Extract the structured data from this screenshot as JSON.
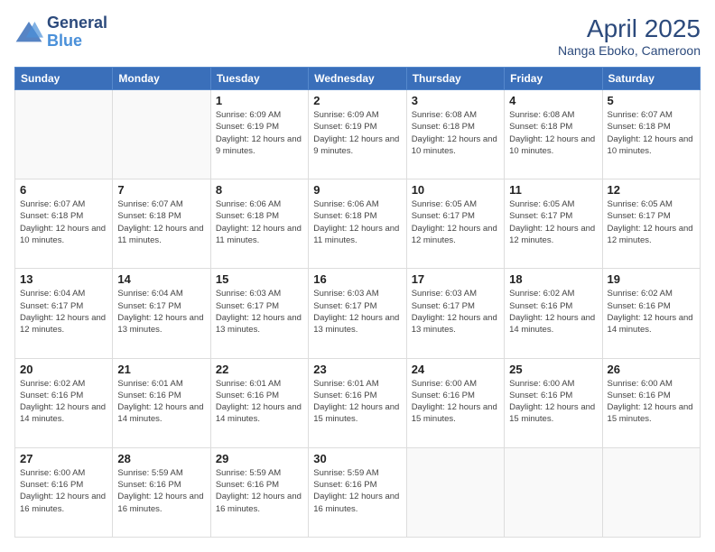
{
  "header": {
    "logo_line1": "General",
    "logo_line2": "Blue",
    "month": "April 2025",
    "location": "Nanga Eboko, Cameroon"
  },
  "weekdays": [
    "Sunday",
    "Monday",
    "Tuesday",
    "Wednesday",
    "Thursday",
    "Friday",
    "Saturday"
  ],
  "weeks": [
    [
      {
        "day": "",
        "info": ""
      },
      {
        "day": "",
        "info": ""
      },
      {
        "day": "1",
        "info": "Sunrise: 6:09 AM\nSunset: 6:19 PM\nDaylight: 12 hours and 9 minutes."
      },
      {
        "day": "2",
        "info": "Sunrise: 6:09 AM\nSunset: 6:19 PM\nDaylight: 12 hours and 9 minutes."
      },
      {
        "day": "3",
        "info": "Sunrise: 6:08 AM\nSunset: 6:18 PM\nDaylight: 12 hours and 10 minutes."
      },
      {
        "day": "4",
        "info": "Sunrise: 6:08 AM\nSunset: 6:18 PM\nDaylight: 12 hours and 10 minutes."
      },
      {
        "day": "5",
        "info": "Sunrise: 6:07 AM\nSunset: 6:18 PM\nDaylight: 12 hours and 10 minutes."
      }
    ],
    [
      {
        "day": "6",
        "info": "Sunrise: 6:07 AM\nSunset: 6:18 PM\nDaylight: 12 hours and 10 minutes."
      },
      {
        "day": "7",
        "info": "Sunrise: 6:07 AM\nSunset: 6:18 PM\nDaylight: 12 hours and 11 minutes."
      },
      {
        "day": "8",
        "info": "Sunrise: 6:06 AM\nSunset: 6:18 PM\nDaylight: 12 hours and 11 minutes."
      },
      {
        "day": "9",
        "info": "Sunrise: 6:06 AM\nSunset: 6:18 PM\nDaylight: 12 hours and 11 minutes."
      },
      {
        "day": "10",
        "info": "Sunrise: 6:05 AM\nSunset: 6:17 PM\nDaylight: 12 hours and 12 minutes."
      },
      {
        "day": "11",
        "info": "Sunrise: 6:05 AM\nSunset: 6:17 PM\nDaylight: 12 hours and 12 minutes."
      },
      {
        "day": "12",
        "info": "Sunrise: 6:05 AM\nSunset: 6:17 PM\nDaylight: 12 hours and 12 minutes."
      }
    ],
    [
      {
        "day": "13",
        "info": "Sunrise: 6:04 AM\nSunset: 6:17 PM\nDaylight: 12 hours and 12 minutes."
      },
      {
        "day": "14",
        "info": "Sunrise: 6:04 AM\nSunset: 6:17 PM\nDaylight: 12 hours and 13 minutes."
      },
      {
        "day": "15",
        "info": "Sunrise: 6:03 AM\nSunset: 6:17 PM\nDaylight: 12 hours and 13 minutes."
      },
      {
        "day": "16",
        "info": "Sunrise: 6:03 AM\nSunset: 6:17 PM\nDaylight: 12 hours and 13 minutes."
      },
      {
        "day": "17",
        "info": "Sunrise: 6:03 AM\nSunset: 6:17 PM\nDaylight: 12 hours and 13 minutes."
      },
      {
        "day": "18",
        "info": "Sunrise: 6:02 AM\nSunset: 6:16 PM\nDaylight: 12 hours and 14 minutes."
      },
      {
        "day": "19",
        "info": "Sunrise: 6:02 AM\nSunset: 6:16 PM\nDaylight: 12 hours and 14 minutes."
      }
    ],
    [
      {
        "day": "20",
        "info": "Sunrise: 6:02 AM\nSunset: 6:16 PM\nDaylight: 12 hours and 14 minutes."
      },
      {
        "day": "21",
        "info": "Sunrise: 6:01 AM\nSunset: 6:16 PM\nDaylight: 12 hours and 14 minutes."
      },
      {
        "day": "22",
        "info": "Sunrise: 6:01 AM\nSunset: 6:16 PM\nDaylight: 12 hours and 14 minutes."
      },
      {
        "day": "23",
        "info": "Sunrise: 6:01 AM\nSunset: 6:16 PM\nDaylight: 12 hours and 15 minutes."
      },
      {
        "day": "24",
        "info": "Sunrise: 6:00 AM\nSunset: 6:16 PM\nDaylight: 12 hours and 15 minutes."
      },
      {
        "day": "25",
        "info": "Sunrise: 6:00 AM\nSunset: 6:16 PM\nDaylight: 12 hours and 15 minutes."
      },
      {
        "day": "26",
        "info": "Sunrise: 6:00 AM\nSunset: 6:16 PM\nDaylight: 12 hours and 15 minutes."
      }
    ],
    [
      {
        "day": "27",
        "info": "Sunrise: 6:00 AM\nSunset: 6:16 PM\nDaylight: 12 hours and 16 minutes."
      },
      {
        "day": "28",
        "info": "Sunrise: 5:59 AM\nSunset: 6:16 PM\nDaylight: 12 hours and 16 minutes."
      },
      {
        "day": "29",
        "info": "Sunrise: 5:59 AM\nSunset: 6:16 PM\nDaylight: 12 hours and 16 minutes."
      },
      {
        "day": "30",
        "info": "Sunrise: 5:59 AM\nSunset: 6:16 PM\nDaylight: 12 hours and 16 minutes."
      },
      {
        "day": "",
        "info": ""
      },
      {
        "day": "",
        "info": ""
      },
      {
        "day": "",
        "info": ""
      }
    ]
  ]
}
